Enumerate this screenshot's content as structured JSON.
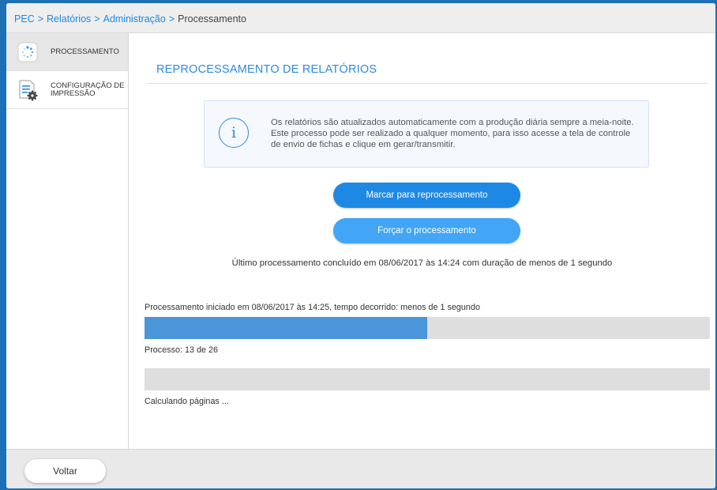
{
  "breadcrumb": {
    "items": [
      "PEC",
      "Relatórios",
      "Administração"
    ],
    "current": "Processamento",
    "separator": ">"
  },
  "sidebar": {
    "items": [
      {
        "label": "Processamento",
        "icon": "loading-spinner-icon",
        "active": true
      },
      {
        "label": "Configuração de impressão",
        "icon": "document-gear-icon",
        "active": false
      }
    ]
  },
  "main": {
    "title": "Reprocessamento de relatórios",
    "info": {
      "icon": "info-icon",
      "text": "Os relatórios são atualizados automaticamente com a produção diária sempre a meia-noite. Este processo pode ser realizado a qualquer momento, para isso acesse a tela de controle de envio de fichas e clique em gerar/transmitir."
    },
    "buttons": {
      "mark": "Marcar para reprocessamento",
      "force": "Forçar o processamento"
    },
    "last_processing": "Último processamento concluído em 08/06/2017 às 14:24 com duração de menos de 1 segundo",
    "progress": {
      "started_text": "Processamento iniciado em 08/06/2017 às 14:25, tempo decorrido: menos de 1 segundo",
      "current": 13,
      "total": 26,
      "count_text": "Processo: 13 de 26",
      "pages_text": "Calculando páginas ..."
    }
  },
  "footer": {
    "back_label": "Voltar"
  },
  "colors": {
    "accent": "#1e88e5",
    "progress_fill": "#4a96d9",
    "track": "#dedede"
  }
}
